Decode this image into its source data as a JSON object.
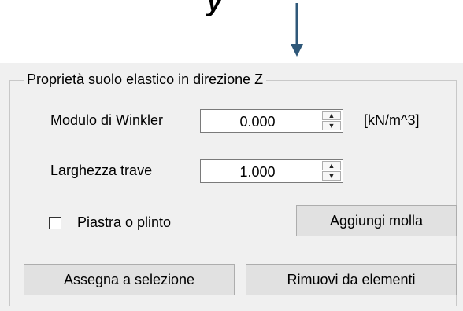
{
  "header_glyph": "y",
  "group": {
    "title": "Proprietà suolo elastico in direzione Z",
    "winkler": {
      "label": "Modulo di Winkler",
      "value": "0.000",
      "unit": "[kN/m^3]"
    },
    "beam_width": {
      "label": "Larghezza trave",
      "value": "1.000"
    },
    "plate_checkbox": {
      "label": "Piastra o plinto",
      "checked": false
    },
    "add_spring_label": "Aggiungi molla",
    "assign_label": "Assegna a selezione",
    "remove_label": "Rimuovi da elementi"
  },
  "colors": {
    "arrow": "#2f5879",
    "panel_bg": "#f0f0f0",
    "button_bg": "#e1e1e1"
  }
}
